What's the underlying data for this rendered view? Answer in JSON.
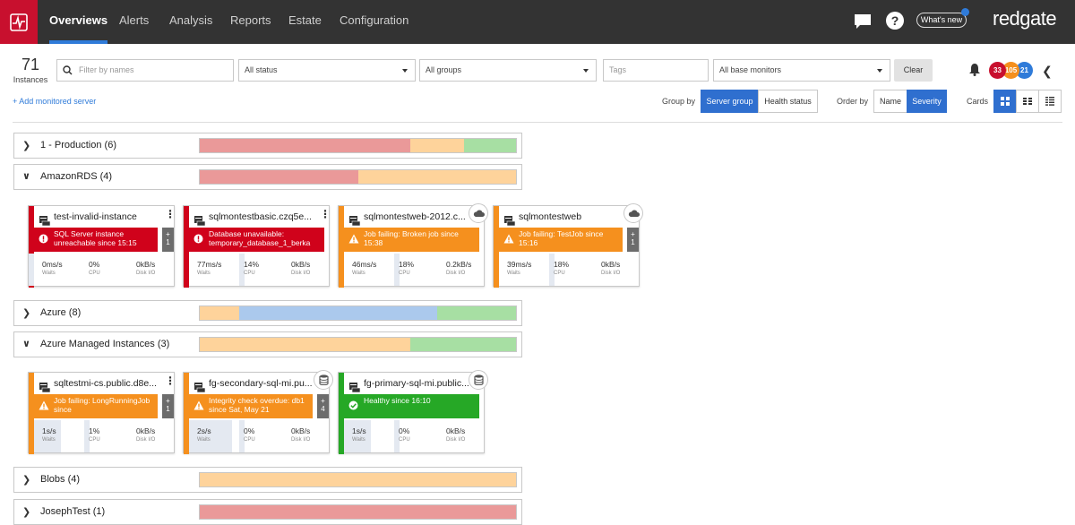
{
  "nav": {
    "items": [
      "Overviews",
      "Alerts",
      "Analysis",
      "Reports",
      "Estate",
      "Configuration"
    ],
    "active": "Overviews",
    "whats_new": "What's new",
    "brand": "redgate"
  },
  "filters": {
    "instances_count": "71",
    "instances_label": "Instances",
    "name_placeholder": "Filter by names",
    "status": "All status",
    "groups": "All groups",
    "tags_placeholder": "Tags",
    "monitors": "All base monitors",
    "clear": "Clear"
  },
  "badges": [
    {
      "value": "33",
      "color": "#c8102e"
    },
    {
      "value": "105",
      "color": "#f5901e"
    },
    {
      "value": "21",
      "color": "#2f7bd9"
    }
  ],
  "toolbar": {
    "add_server": "+ Add monitored server",
    "group_by": "Group by",
    "group_opts": [
      "Server group",
      "Health status"
    ],
    "order_by": "Order by",
    "order_opts": [
      "Name",
      "Severity"
    ],
    "cards": "Cards"
  },
  "groups": [
    {
      "name": "1 - Production (6)",
      "expanded": false,
      "split": [
        66.5,
        17,
        16.5
      ]
    },
    {
      "name": "AmazonRDS (4)",
      "expanded": true,
      "split": [
        50,
        50
      ]
    },
    {
      "name": "Azure (8)",
      "expanded": false,
      "split": [
        12.5,
        62.5,
        25
      ]
    },
    {
      "name": "Azure Managed Instances (3)",
      "expanded": true,
      "split": [
        66.7,
        33.3
      ]
    },
    {
      "name": "Blobs (4)",
      "expanded": false,
      "split": [
        100
      ]
    },
    {
      "name": "JosephTest (1)",
      "expanded": false,
      "split": [
        100
      ]
    }
  ],
  "metric_labels": {
    "waits": "Waits",
    "cpu": "CPU",
    "disk": "Disk I/O"
  },
  "cards_amazon": [
    {
      "title": "test-invalid-instance",
      "status": "SQL Server instance unreachable since 15:15",
      "severity": "red",
      "plus": "+\n1",
      "waits": "0ms/s",
      "cpu": "0%",
      "disk": "0kB/s",
      "cloud": false
    },
    {
      "title": "sqlmontestbasic.czq5e...",
      "status": "Database unavailable: temporary_database_1_berka",
      "severity": "red",
      "plus": "",
      "waits": "77ms/s",
      "cpu": "14%",
      "disk": "0kB/s",
      "cloud": false
    },
    {
      "title": "sqlmontestweb-2012.c...",
      "status": "Job failing: Broken job since 15:38",
      "severity": "orange",
      "plus": "",
      "waits": "46ms/s",
      "cpu": "18%",
      "disk": "0.2kB/s",
      "cloud": true
    },
    {
      "title": "sqlmontestweb",
      "status": "Job failing: TestJob since 15:16",
      "severity": "orange",
      "plus": "+\n1",
      "waits": "39ms/s",
      "cpu": "18%",
      "disk": "0kB/s",
      "cloud": true
    }
  ],
  "cards_azure_mi": [
    {
      "title": "sqltestmi-cs.public.d8e...",
      "status": "Job failing: LongRunningJob since",
      "severity": "orange",
      "plus": "+\n1",
      "waits": "1s/s",
      "cpu": "1%",
      "disk": "0kB/s",
      "db": false
    },
    {
      "title": "fg-secondary-sql-mi.pu...",
      "status": "Integrity check overdue: db1 since Sat, May 21",
      "severity": "orange",
      "plus": "+\n4",
      "waits": "2s/s",
      "cpu": "0%",
      "disk": "0kB/s",
      "db": true
    },
    {
      "title": "fg-primary-sql-mi.public...",
      "status": "Healthy since 16:10",
      "severity": "green",
      "plus": "",
      "waits": "1s/s",
      "cpu": "0%",
      "disk": "0kB/s",
      "db": true
    }
  ],
  "colors": {
    "red": "#d0021b",
    "orange": "#f5901e",
    "green": "#26a826",
    "accent": "#2f6fcf"
  }
}
